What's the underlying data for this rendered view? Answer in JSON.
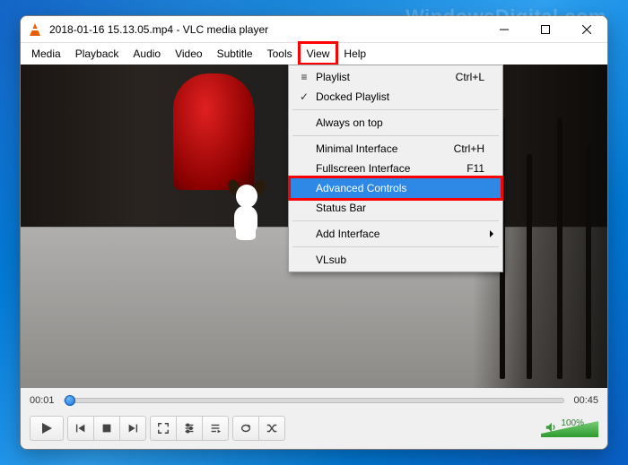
{
  "watermark": "WindowsDigital.com",
  "window": {
    "title": "2018-01-16 15.13.05.mp4 - VLC media player"
  },
  "menubar": {
    "items": [
      "Media",
      "Playback",
      "Audio",
      "Video",
      "Subtitle",
      "Tools",
      "View",
      "Help"
    ],
    "active_index": 6
  },
  "view_menu": {
    "items": [
      {
        "label": "Playlist",
        "accel": "Ctrl+L",
        "icon": "list"
      },
      {
        "label": "Docked Playlist",
        "accel": "",
        "icon": "check"
      },
      {
        "sep": true
      },
      {
        "label": "Always on top",
        "accel": ""
      },
      {
        "sep": true
      },
      {
        "label": "Minimal Interface",
        "accel": "Ctrl+H"
      },
      {
        "label": "Fullscreen Interface",
        "accel": "F11"
      },
      {
        "label": "Advanced Controls",
        "accel": "",
        "highlighted": true
      },
      {
        "label": "Status Bar",
        "accel": ""
      },
      {
        "sep": true
      },
      {
        "label": "Add Interface",
        "accel": "",
        "submenu": true
      },
      {
        "sep": true
      },
      {
        "label": "VLsub",
        "accel": ""
      }
    ]
  },
  "playback": {
    "elapsed": "00:01",
    "total": "00:45",
    "volume_pct": "100%"
  }
}
